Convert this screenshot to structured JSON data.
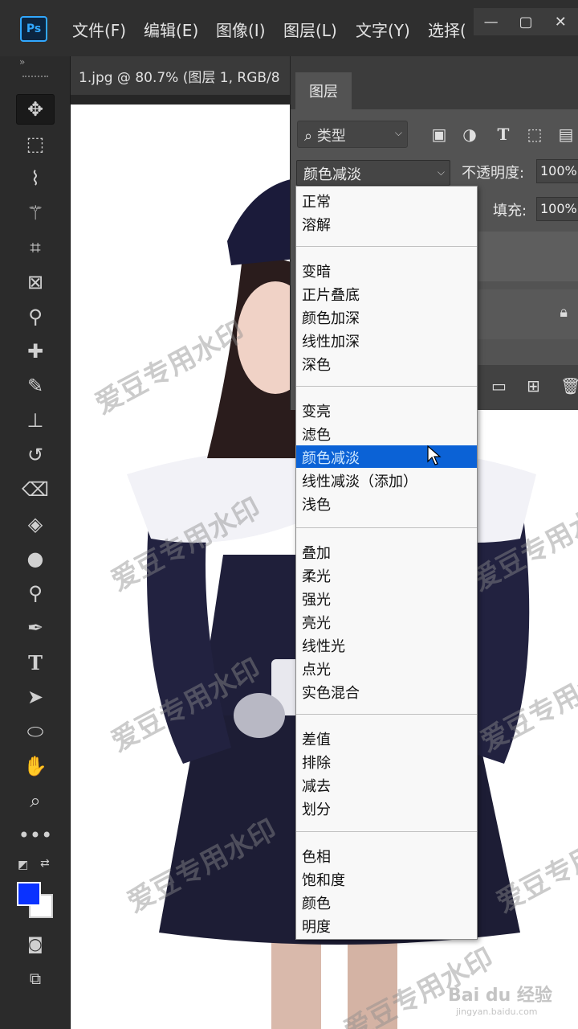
{
  "app": {
    "logo_text": "Ps"
  },
  "menu": [
    "文件(F)",
    "编辑(E)",
    "图像(I)",
    "图层(L)",
    "文字(Y)",
    "选择("
  ],
  "window_controls": [
    "—",
    "▢",
    "✕"
  ],
  "document": {
    "tab_title": "1.jpg @ 80.7% (图层 1, RGB/8"
  },
  "tools": [
    "move-tool",
    "marquee-tool",
    "lasso-tool",
    "magic-wand-tool",
    "crop-tool",
    "frame-tool",
    "eyedropper-tool",
    "healing-brush-tool",
    "brush-tool",
    "clone-stamp-tool",
    "history-brush-tool",
    "eraser-tool",
    "paint-bucket-tool",
    "blur-tool",
    "dodge-tool",
    "pen-tool",
    "type-tool",
    "path-selection-tool",
    "ellipse-tool",
    "hand-tool",
    "zoom-tool",
    "more-tools"
  ],
  "colors": {
    "foreground": "#0a32ff",
    "background": "#ffffff",
    "selection": "#0b62d6"
  },
  "layers_panel": {
    "tab": "图层",
    "filter_label": "类型",
    "blend_mode": "颜色减淡",
    "opacity_label": "不透明度:",
    "opacity_value": "100%",
    "fill_label": "填充:",
    "fill_value": "100%"
  },
  "blend_modes": [
    [
      "正常",
      "溶解"
    ],
    [
      "变暗",
      "正片叠底",
      "颜色加深",
      "线性加深",
      "深色"
    ],
    [
      "变亮",
      "滤色",
      "颜色减淡",
      "线性减淡（添加）",
      "浅色"
    ],
    [
      "叠加",
      "柔光",
      "强光",
      "亮光",
      "线性光",
      "点光",
      "实色混合"
    ],
    [
      "差值",
      "排除",
      "减去",
      "划分"
    ],
    [
      "色相",
      "饱和度",
      "颜色",
      "明度"
    ]
  ],
  "selected_blend_mode": "颜色减淡",
  "watermark_text": "爱豆专用水印",
  "site_badge": {
    "logo": "Bai du 经验",
    "url": "jingyan.baidu.com"
  }
}
